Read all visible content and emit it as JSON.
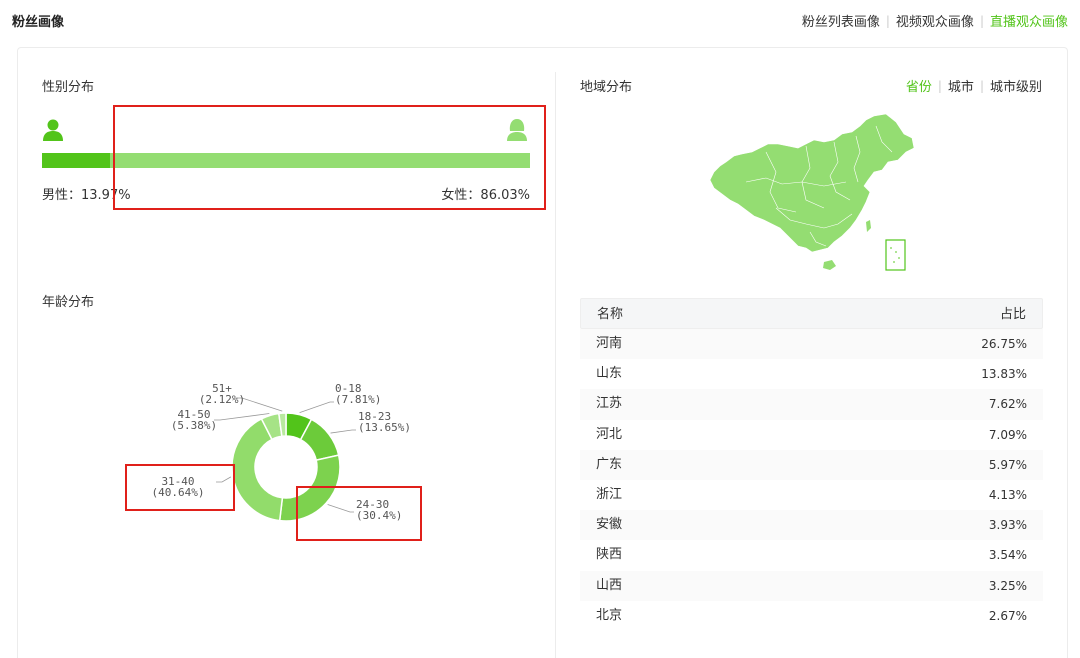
{
  "page_title": "粉丝画像",
  "top_links": [
    {
      "label": "粉丝列表画像",
      "active": false
    },
    {
      "label": "视频观众画像",
      "active": false
    },
    {
      "label": "直播观众画像",
      "active": true
    }
  ],
  "gender": {
    "title": "性别分布",
    "male_label": "男性：13.97%",
    "female_label": "女性：86.03%",
    "male_fraction": 0.1397,
    "female_fraction": 0.8603,
    "male_color": "#52c41a",
    "female_color": "#94dd72",
    "male_icon": "male-user-icon",
    "female_icon": "female-user-icon"
  },
  "age": {
    "title": "年龄分布"
  },
  "chart_data": {
    "type": "pie",
    "donut": true,
    "categories": [
      "0-18",
      "18-23",
      "24-30",
      "31-40",
      "41-50",
      "51+"
    ],
    "values": [
      7.81,
      13.65,
      30.4,
      40.64,
      5.38,
      2.12
    ],
    "labels": [
      "(7.81%)",
      "(13.65%)",
      "(30.4%)",
      "(40.64%)",
      "(5.38%)",
      "(2.12%)"
    ],
    "colors": [
      "#52c41a",
      "#6ccb3a",
      "#7dd24e",
      "#92dc6b",
      "#a6e386",
      "#b9e99f"
    ]
  },
  "region": {
    "title": "地域分布",
    "tabs": [
      {
        "label": "省份",
        "active": true
      },
      {
        "label": "城市",
        "active": false
      },
      {
        "label": "城市级别",
        "active": false
      }
    ],
    "map_color": "#94dd72",
    "table": {
      "headers": [
        "名称",
        "占比"
      ],
      "rows": [
        {
          "name": "河南",
          "value": "26.75%"
        },
        {
          "name": "山东",
          "value": "13.83%"
        },
        {
          "name": "江苏",
          "value": "7.62%"
        },
        {
          "name": "河北",
          "value": "7.09%"
        },
        {
          "name": "广东",
          "value": "5.97%"
        },
        {
          "name": "浙江",
          "value": "4.13%"
        },
        {
          "name": "安徽",
          "value": "3.93%"
        },
        {
          "name": "陕西",
          "value": "3.54%"
        },
        {
          "name": "山西",
          "value": "3.25%"
        },
        {
          "name": "北京",
          "value": "2.67%"
        }
      ]
    }
  }
}
